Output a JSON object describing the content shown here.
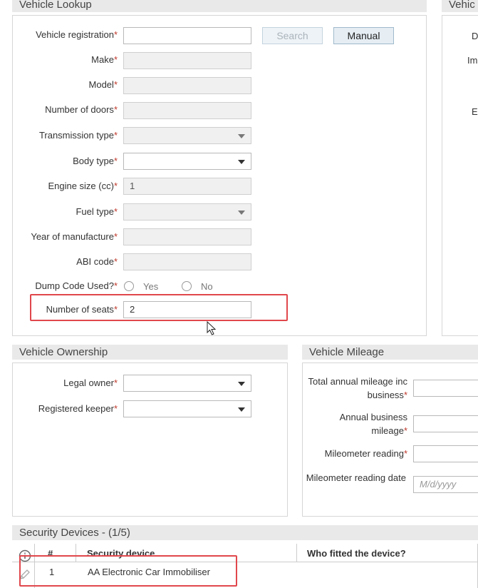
{
  "sections": {
    "vehicle_lookup": "Vehicle Lookup",
    "vehicle_right": "Vehic",
    "vehicle_ownership": "Vehicle Ownership",
    "vehicle_mileage": "Vehicle Mileage",
    "security_devices": "Security Devices - (1/5)"
  },
  "lookup": {
    "registration_label": "Vehicle registration",
    "search_label": "Search",
    "manual_label": "Manual",
    "make_label": "Make",
    "model_label": "Model",
    "doors_label": "Number of doors",
    "transmission_label": "Transmission type",
    "body_label": "Body type",
    "engine_label": "Engine size (cc)",
    "engine_value": "1",
    "fuel_label": "Fuel type",
    "year_label": "Year of manufacture",
    "abi_label": "ABI code",
    "dump_label": "Dump Code Used?",
    "dump_yes": "Yes",
    "dump_no": "No",
    "seats_label": "Number of seats",
    "seats_value": "2"
  },
  "right_panel_fragments": [
    "D",
    "Im",
    "E"
  ],
  "ownership": {
    "legal_owner_label": "Legal owner",
    "registered_keeper_label": "Registered keeper"
  },
  "mileage": {
    "total_annual_label": "Total annual mileage inc business",
    "annual_business_label": "Annual business mileage",
    "mileometer_label": "Mileometer reading",
    "mileometer_date_label": "Mileometer reading date",
    "date_placeholder": "M/d/yyyy"
  },
  "required_marker": "*",
  "security_table": {
    "headers": [
      "#",
      "Security device",
      "Who fitted the device?"
    ],
    "rows": [
      {
        "num": "1",
        "device": "AA Electronic Car Immobiliser",
        "fitted_by": ""
      }
    ]
  }
}
